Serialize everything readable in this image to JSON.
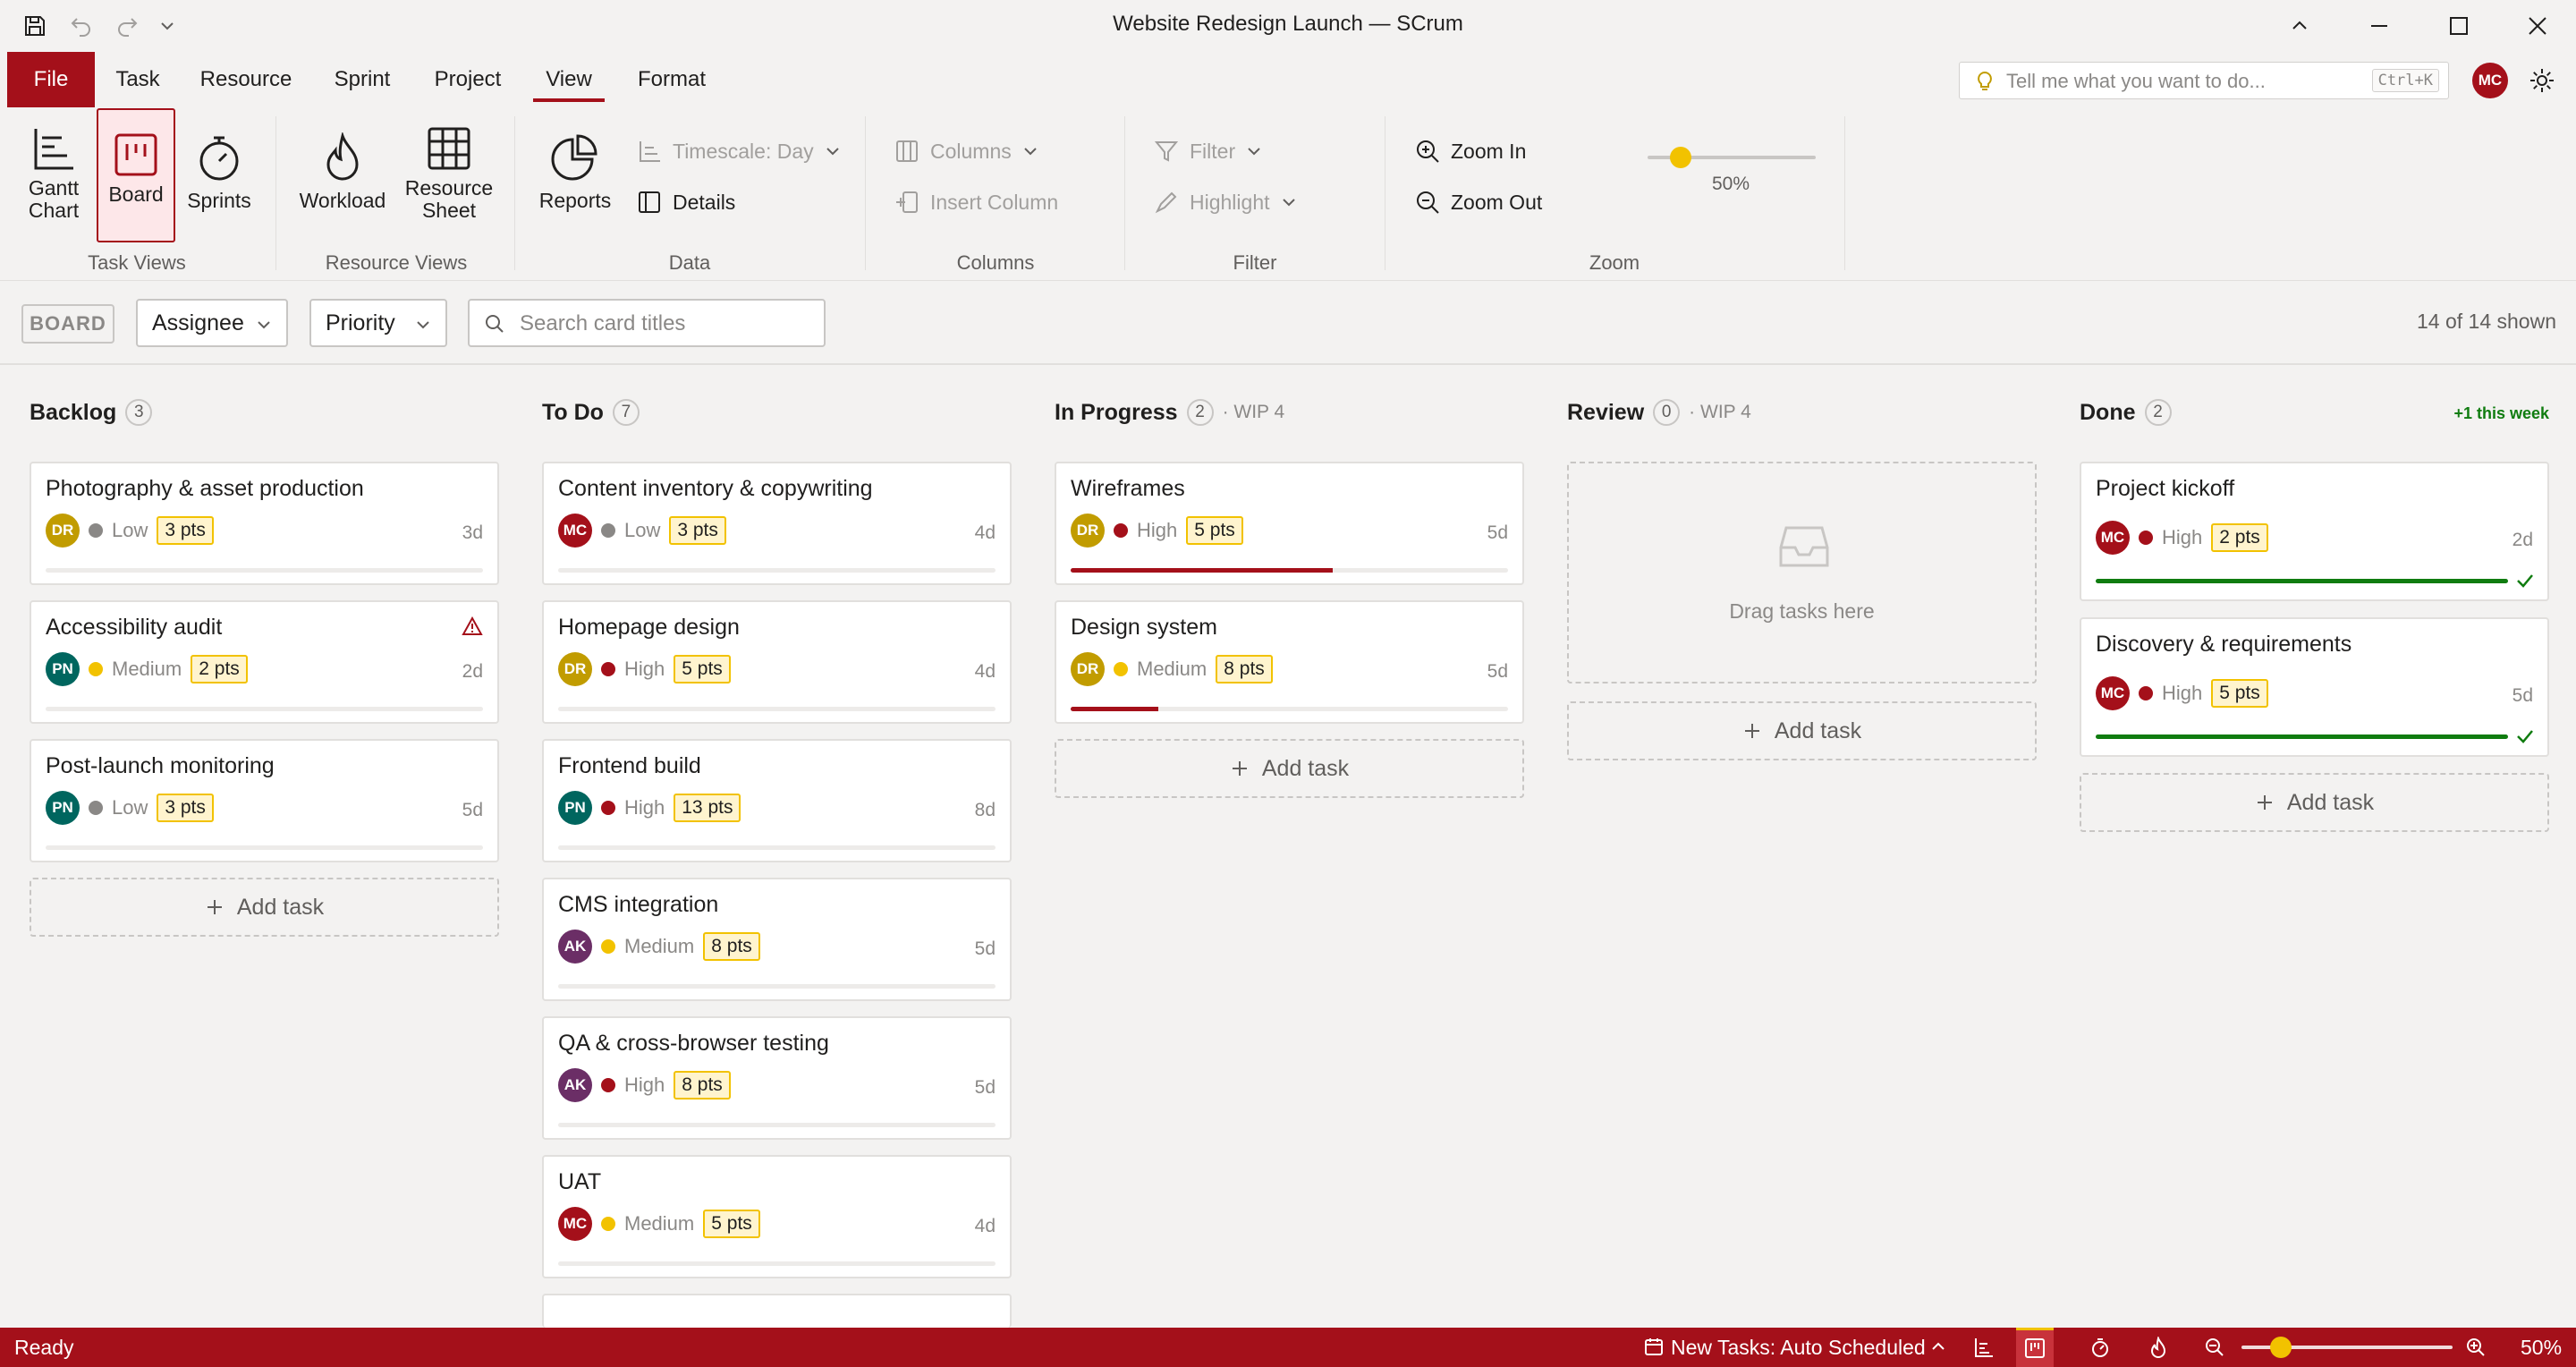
{
  "window": {
    "title": "Website Redesign Launch — SCrum"
  },
  "menu": {
    "file": "File",
    "tabs": [
      "Task",
      "Resource",
      "Sprint",
      "Project",
      "View",
      "Format"
    ],
    "active_tab": "View",
    "tell_me_placeholder": "Tell me what you want to do...",
    "tell_me_shortcut": "Ctrl+K",
    "user_initials": "MC"
  },
  "ribbon": {
    "task_views": {
      "label": "Task Views",
      "gantt": "Gantt Chart",
      "board": "Board",
      "sprints": "Sprints"
    },
    "resource_views": {
      "label": "Resource Views",
      "workload": "Workload",
      "resource_sheet": "Resource Sheet"
    },
    "data": {
      "label": "Data",
      "reports": "Reports",
      "timescale": "Timescale: Day",
      "details": "Details"
    },
    "columns": {
      "label": "Columns",
      "columns": "Columns",
      "insert_column": "Insert Column"
    },
    "filter": {
      "label": "Filter",
      "filter": "Filter",
      "highlight": "Highlight"
    },
    "zoom": {
      "label": "Zoom",
      "zoom_in": "Zoom In",
      "zoom_out": "Zoom Out",
      "level": "50%",
      "level_fraction": 0.15
    }
  },
  "toolbar": {
    "board_tag": "BOARD",
    "assignee": "Assignee",
    "priority": "Priority",
    "search_placeholder": "Search card titles",
    "shown": "14 of 14 shown"
  },
  "board": {
    "columns": [
      {
        "name": "Backlog",
        "count": "3",
        "wip": "",
        "note": "",
        "cards": [
          {
            "title": "Photography & asset production",
            "assignee": "DR",
            "priority": "Low",
            "points": "3 pts",
            "duration": "3d",
            "progress": 0,
            "warning": false
          },
          {
            "title": "Accessibility audit",
            "assignee": "PN",
            "priority": "Medium",
            "points": "2 pts",
            "duration": "2d",
            "progress": 0,
            "warning": true
          },
          {
            "title": "Post-launch monitoring",
            "assignee": "PN",
            "priority": "Low",
            "points": "3 pts",
            "duration": "5d",
            "progress": 0,
            "warning": false
          }
        ]
      },
      {
        "name": "To Do",
        "count": "7",
        "wip": "",
        "note": "",
        "cards": [
          {
            "title": "Content inventory & copywriting",
            "assignee": "MC",
            "priority": "Low",
            "points": "3 pts",
            "duration": "4d",
            "progress": 0
          },
          {
            "title": "Homepage design",
            "assignee": "DR",
            "priority": "High",
            "points": "5 pts",
            "duration": "4d",
            "progress": 0
          },
          {
            "title": "Frontend build",
            "assignee": "PN",
            "priority": "High",
            "points": "13 pts",
            "duration": "8d",
            "progress": 0
          },
          {
            "title": "CMS integration",
            "assignee": "AK",
            "priority": "Medium",
            "points": "8 pts",
            "duration": "5d",
            "progress": 0
          },
          {
            "title": "QA & cross-browser testing",
            "assignee": "AK",
            "priority": "High",
            "points": "8 pts",
            "duration": "5d",
            "progress": 0
          },
          {
            "title": "UAT",
            "assignee": "MC",
            "priority": "Medium",
            "points": "5 pts",
            "duration": "4d",
            "progress": 0
          }
        ]
      },
      {
        "name": "In Progress",
        "count": "2",
        "wip": "· WIP 4",
        "note": "",
        "cards": [
          {
            "title": "Wireframes",
            "assignee": "DR",
            "priority": "High",
            "points": "5 pts",
            "duration": "5d",
            "progress": 0.6
          },
          {
            "title": "Design system",
            "assignee": "DR",
            "priority": "Medium",
            "points": "8 pts",
            "duration": "5d",
            "progress": 0.2
          }
        ]
      },
      {
        "name": "Review",
        "count": "0",
        "wip": "· WIP 4",
        "note": "",
        "empty_text": "Drag tasks here",
        "cards": []
      },
      {
        "name": "Done",
        "count": "2",
        "wip": "",
        "note": "+1 this week",
        "cards": [
          {
            "title": "Project kickoff",
            "assignee": "MC",
            "priority": "High",
            "points": "2 pts",
            "duration": "2d",
            "progress": 1
          },
          {
            "title": "Discovery & requirements",
            "assignee": "MC",
            "priority": "High",
            "points": "5 pts",
            "duration": "5d",
            "progress": 1
          }
        ]
      }
    ],
    "add_task": "Add task"
  },
  "assignee_colors": {
    "DR": "#c19c00",
    "PN": "#00665f",
    "MC": "#a4101a",
    "AK": "#6b2e66"
  },
  "priority_colors": {
    "Low": "#8a8886",
    "Medium": "#f2c200",
    "High": "#a4101a"
  },
  "colors": {
    "accent": "#a4101a",
    "done": "#107c10"
  },
  "status": {
    "ready": "Ready",
    "scheduling": "New Tasks: Auto Scheduled",
    "zoom": "50%",
    "zoom_fraction": 0.15
  }
}
